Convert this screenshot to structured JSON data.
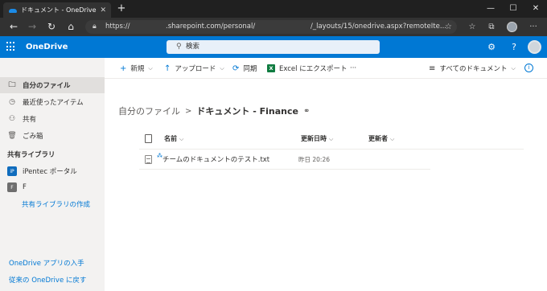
{
  "browser": {
    "tab_title": "ドキュメント - OneDrive",
    "tab_close": "✕",
    "new_tab": "+",
    "url": {
      "scheme": "https://",
      "host": ".sharepoint.com/personal/",
      "path": "/_layouts/15/onedrive.aspx?remoteIte..."
    },
    "window_controls": {
      "minimize": "—",
      "maximize": "☐",
      "close": "✕"
    }
  },
  "app": {
    "title": "OneDrive",
    "search_placeholder": "検索",
    "help_symbol": "?"
  },
  "sidebar": {
    "items": [
      {
        "label": "自分のファイル",
        "icon": "folder-icon"
      },
      {
        "label": "最近使ったアイテム",
        "icon": "clock-icon"
      },
      {
        "label": "共有",
        "icon": "people-icon"
      },
      {
        "label": "ごみ箱",
        "icon": "trash-icon"
      }
    ],
    "shared_libraries_heading": "共有ライブラリ",
    "libraries": [
      {
        "label": "iPentec ポータル",
        "tile_color": "#0f6cbd",
        "tile_text": "iP"
      },
      {
        "label": "F",
        "tile_color": "#6e6e6e",
        "tile_text": "F"
      }
    ],
    "create_library_link": "共有ライブラリの作成",
    "get_apps_link": "OneDrive アプリの入手",
    "classic_link": "従来の OneDrive に戻す"
  },
  "command_bar": {
    "new_label": "新規",
    "upload_label": "アップロード",
    "sync_label": "同期",
    "export_label": "Excel にエクスポート",
    "more_label": "···",
    "view_label": "すべてのドキュメント",
    "excel_badge": "X"
  },
  "breadcrumb": {
    "root": "自分のファイル",
    "separator": ">",
    "current": "ドキュメント - Finance"
  },
  "list": {
    "columns": {
      "name": "名前",
      "modified": "更新日時",
      "modified_by": "更新者"
    },
    "rows": [
      {
        "name": "チームのドキュメントのテスト.txt",
        "modified": "昨日 20:26",
        "modified_by": ""
      }
    ]
  },
  "colors": {
    "brand": "#0078d4",
    "nav_bg": "#f3f2f1",
    "chrome_dark": "#202020"
  }
}
